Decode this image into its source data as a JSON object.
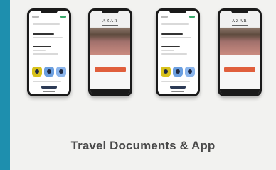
{
  "card": {
    "title": "Travel Documents & App"
  },
  "phones": [
    {
      "variant": "light"
    },
    {
      "variant": "dark",
      "brand": "AZAR"
    },
    {
      "variant": "light"
    },
    {
      "variant": "dark",
      "brand": "AZAR"
    }
  ],
  "colors": {
    "background": "#1e8fae",
    "card": "#f2f2f0",
    "title_text": "#4a4a4a",
    "accent_orange": "#e05f3d",
    "icon_yellow": "#d8c21c",
    "icon_blue": "#6b9fe0"
  }
}
